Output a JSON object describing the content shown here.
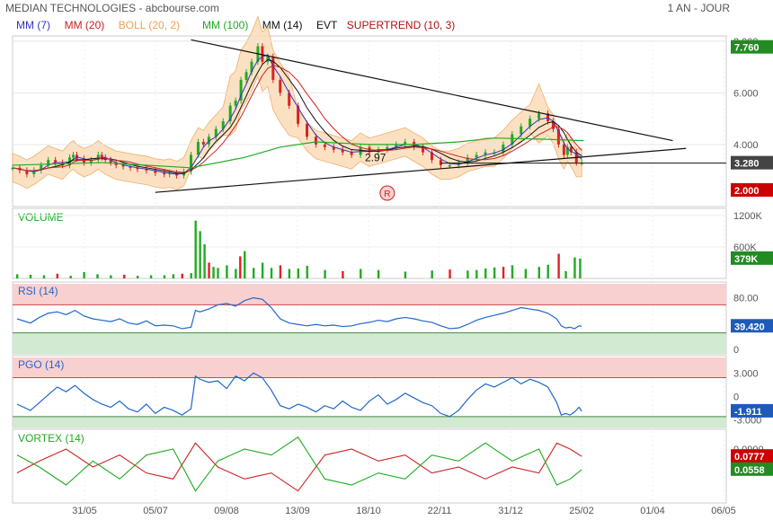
{
  "header": {
    "title": "MEDIAN TECHNOLOGIES - abcbourse.com",
    "period": "1 AN - JOUR"
  },
  "legend": [
    {
      "label": "MM (7)",
      "color": "#3333cc"
    },
    {
      "label": "MM (20)",
      "color": "#cc2222"
    },
    {
      "label": "BOLL (20, 2)",
      "color": "#f0a050"
    },
    {
      "label": "MM (100)",
      "color": "#22aa22"
    },
    {
      "label": "MM (14)",
      "color": "#111111"
    },
    {
      "label": "EVT",
      "color": "#111111"
    },
    {
      "label": "SUPERTREND (10, 3)",
      "color": "#aa1111"
    }
  ],
  "colors": {
    "up": "#22aa22",
    "down": "#dd2222",
    "boll_fill": "#fbdcb8",
    "rsi": "#2266cc",
    "green_tag": "#228b22",
    "red_tag": "#cc0000",
    "blue_tag": "#1e5bb8",
    "dark_tag": "#444444"
  },
  "x_axis": {
    "labels": [
      "31/05",
      "05/07",
      "09/08",
      "13/09",
      "18/10",
      "22/11",
      "31/12",
      "25/02",
      "01/04",
      "06/05"
    ]
  },
  "chart_data": [
    {
      "type": "line",
      "name": "price",
      "y_ticks": [
        "8.000",
        "6.000",
        "4.000"
      ],
      "ylim": [
        1.6,
        8.2
      ],
      "annotations": {
        "low_label": "2.97",
        "marker": "R",
        "low_value": 2.97
      },
      "tags": {
        "last": "7.760",
        "current": "3.280",
        "low": "2.000"
      },
      "series": [
        {
          "name": "Close",
          "x": [
            0,
            8,
            16,
            24,
            32,
            40,
            48,
            56,
            64,
            68,
            72,
            80,
            88,
            96,
            100,
            104,
            110,
            116,
            124,
            132,
            140,
            150,
            160,
            170,
            176,
            184,
            192,
            200,
            208,
            214,
            220,
            228,
            236,
            244,
            250,
            256,
            262,
            268,
            275,
            280,
            286,
            292,
            300,
            310,
            320,
            330,
            340,
            350,
            360,
            370,
            380,
            390,
            400,
            410,
            420,
            430,
            440,
            450,
            460,
            470,
            480,
            490,
            500,
            510,
            520,
            530,
            540,
            550,
            560,
            570,
            580,
            590,
            600,
            606,
            612,
            618,
            622,
            626,
            632,
            638
          ],
          "values": [
            3.1,
            3.0,
            2.85,
            3.0,
            3.2,
            3.4,
            3.3,
            3.2,
            3.5,
            3.6,
            3.45,
            3.3,
            3.4,
            3.6,
            3.5,
            3.4,
            3.3,
            3.2,
            3.15,
            3.1,
            3.05,
            3.0,
            2.9,
            2.85,
            2.9,
            2.8,
            2.95,
            3.6,
            4.1,
            4.0,
            4.3,
            4.6,
            4.9,
            5.5,
            5.7,
            6.5,
            6.8,
            7.2,
            7.8,
            7.2,
            7.4,
            6.5,
            6.0,
            5.5,
            4.8,
            4.3,
            4.0,
            3.9,
            3.8,
            3.7,
            3.6,
            3.9,
            3.7,
            3.8,
            3.9,
            4.0,
            4.1,
            3.9,
            3.7,
            3.4,
            3.2,
            3.2,
            3.3,
            3.5,
            3.6,
            3.7,
            3.7,
            4.0,
            4.4,
            4.7,
            5.0,
            5.2,
            4.9,
            4.6,
            4.0,
            3.6,
            3.9,
            3.7,
            3.3,
            3.3
          ]
        },
        {
          "name": "MM (100)",
          "x": [
            0,
            100,
            200,
            260,
            300,
            340,
            400,
            450,
            500,
            540,
            600,
            640
          ],
          "values": [
            3.2,
            3.3,
            3.1,
            3.5,
            3.9,
            4.1,
            4.0,
            4.0,
            4.1,
            4.25,
            4.2,
            4.15
          ]
        },
        {
          "name": "Trend top",
          "x": [
            200,
            740
          ],
          "values": [
            8.05,
            4.15
          ]
        },
        {
          "name": "Trend bottom",
          "x": [
            160,
            755
          ],
          "values": [
            2.15,
            3.85
          ]
        }
      ]
    },
    {
      "type": "bar",
      "name": "volume",
      "title": "VOLUME",
      "y_ticks": [
        "1200K",
        "600K"
      ],
      "ylim": [
        0,
        1300
      ],
      "tag": "379K",
      "x": [
        5,
        20,
        35,
        50,
        65,
        80,
        95,
        110,
        125,
        140,
        155,
        170,
        180,
        190,
        200,
        205,
        210,
        215,
        220,
        225,
        230,
        240,
        250,
        255,
        260,
        270,
        280,
        290,
        300,
        310,
        320,
        330,
        350,
        370,
        390,
        410,
        440,
        470,
        490,
        510,
        520,
        530,
        540,
        550,
        560,
        575,
        590,
        600,
        612,
        620,
        630,
        636
      ],
      "values": [
        80,
        70,
        60,
        90,
        50,
        120,
        80,
        60,
        70,
        50,
        60,
        60,
        80,
        90,
        100,
        1100,
        900,
        650,
        300,
        220,
        200,
        250,
        180,
        420,
        520,
        200,
        300,
        200,
        250,
        180,
        190,
        240,
        160,
        140,
        180,
        160,
        130,
        150,
        170,
        150,
        160,
        190,
        210,
        220,
        250,
        180,
        220,
        260,
        470,
        140,
        400,
        379
      ]
    },
    {
      "type": "line",
      "name": "rsi",
      "title": "RSI (14)",
      "y_ticks": [
        "80.00",
        "0"
      ],
      "ylim": [
        0,
        100
      ],
      "bands": [
        30,
        70
      ],
      "tag": "39.420",
      "x": [
        5,
        20,
        30,
        40,
        50,
        60,
        70,
        80,
        90,
        100,
        110,
        120,
        130,
        140,
        150,
        160,
        170,
        180,
        190,
        200,
        205,
        210,
        220,
        230,
        240,
        250,
        260,
        270,
        280,
        290,
        300,
        310,
        320,
        330,
        340,
        350,
        360,
        370,
        380,
        390,
        400,
        410,
        420,
        430,
        440,
        450,
        460,
        470,
        480,
        490,
        500,
        510,
        520,
        530,
        540,
        550,
        560,
        570,
        580,
        590,
        600,
        610,
        615,
        620,
        625,
        630,
        635,
        638
      ],
      "values": [
        50,
        44,
        52,
        58,
        60,
        56,
        62,
        54,
        50,
        48,
        46,
        50,
        44,
        42,
        47,
        40,
        41,
        40,
        36,
        38,
        62,
        60,
        64,
        70,
        72,
        68,
        76,
        80,
        78,
        66,
        50,
        44,
        42,
        40,
        42,
        40,
        41,
        39,
        40,
        43,
        45,
        48,
        46,
        50,
        52,
        50,
        47,
        45,
        40,
        36,
        37,
        42,
        48,
        52,
        55,
        58,
        62,
        66,
        64,
        62,
        58,
        50,
        40,
        37,
        38,
        36,
        40,
        39.42
      ]
    },
    {
      "type": "line",
      "name": "pgo",
      "title": "PGO (14)",
      "y_ticks": [
        "3.000",
        "0",
        "-3.000"
      ],
      "ylim": [
        -4,
        5
      ],
      "bands": [
        -2.6,
        2.4
      ],
      "tag": "-1.911",
      "x": [
        5,
        20,
        30,
        40,
        50,
        60,
        70,
        80,
        90,
        100,
        110,
        120,
        130,
        140,
        150,
        160,
        170,
        180,
        190,
        200,
        205,
        210,
        220,
        230,
        240,
        250,
        260,
        270,
        280,
        290,
        300,
        310,
        320,
        330,
        340,
        350,
        360,
        370,
        380,
        390,
        400,
        410,
        420,
        430,
        440,
        450,
        460,
        470,
        480,
        490,
        500,
        510,
        520,
        530,
        540,
        550,
        560,
        570,
        580,
        590,
        600,
        610,
        615,
        620,
        625,
        630,
        635,
        638
      ],
      "values": [
        -1.0,
        -1.8,
        -0.8,
        0.2,
        1.2,
        0.6,
        1.4,
        0.4,
        -0.4,
        -1.0,
        -1.4,
        -0.6,
        -1.6,
        -2.0,
        -1.0,
        -2.2,
        -1.4,
        -1.8,
        -2.4,
        -1.6,
        2.6,
        2.2,
        1.8,
        2.0,
        1.0,
        2.6,
        2.0,
        3.0,
        2.4,
        0.8,
        -1.2,
        -1.6,
        -1.0,
        -1.4,
        -2.0,
        -1.2,
        -1.6,
        -0.6,
        -1.4,
        -1.8,
        -0.6,
        0.2,
        -1.0,
        -0.4,
        0.4,
        -0.2,
        -0.8,
        -1.2,
        -2.2,
        -2.6,
        -1.8,
        -0.4,
        0.8,
        1.6,
        1.2,
        1.8,
        2.4,
        1.6,
        2.2,
        1.8,
        1.2,
        -0.8,
        -2.4,
        -2.2,
        -2.4,
        -2.0,
        -1.4,
        -1.911
      ]
    },
    {
      "type": "line",
      "name": "vortex",
      "title": "VORTEX (14)",
      "y_ticks": [
        "0.0900"
      ],
      "ylim": [
        0,
        0.12
      ],
      "tags": {
        "vi_plus": "0.0777",
        "vi_minus": "0.0558"
      },
      "series": [
        {
          "name": "VI-",
          "x": [
            5,
            30,
            60,
            90,
            120,
            150,
            180,
            205,
            230,
            260,
            290,
            320,
            350,
            380,
            410,
            440,
            470,
            500,
            530,
            560,
            590,
            610,
            625,
            638
          ],
          "values": [
            0.05,
            0.07,
            0.09,
            0.06,
            0.08,
            0.05,
            0.04,
            0.1,
            0.06,
            0.04,
            0.05,
            0.02,
            0.08,
            0.09,
            0.07,
            0.08,
            0.05,
            0.06,
            0.04,
            0.06,
            0.05,
            0.1,
            0.09,
            0.0777
          ]
        },
        {
          "name": "VI+",
          "x": [
            5,
            30,
            60,
            90,
            120,
            150,
            180,
            205,
            230,
            260,
            290,
            320,
            350,
            380,
            410,
            440,
            470,
            500,
            530,
            560,
            590,
            610,
            625,
            638
          ],
          "values": [
            0.08,
            0.06,
            0.03,
            0.07,
            0.04,
            0.08,
            0.09,
            0.02,
            0.07,
            0.09,
            0.08,
            0.11,
            0.04,
            0.03,
            0.05,
            0.04,
            0.08,
            0.07,
            0.1,
            0.07,
            0.09,
            0.03,
            0.04,
            0.0558
          ]
        }
      ]
    }
  ]
}
